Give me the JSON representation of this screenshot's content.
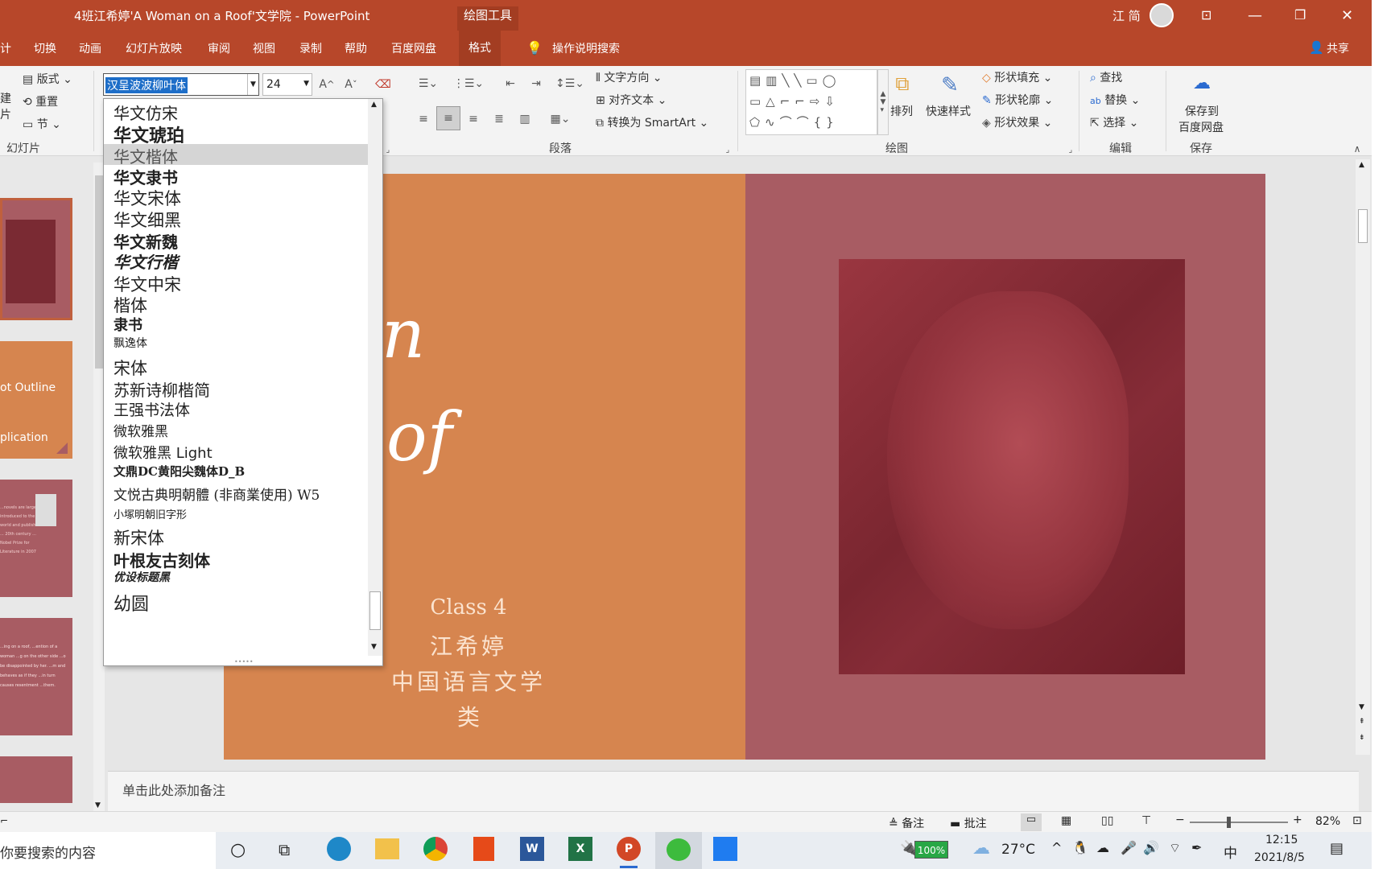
{
  "window": {
    "title": "4班江希婷'A Woman on a Roof'文学院  -  PowerPoint",
    "context_tool": "绘图工具",
    "user": "江 简"
  },
  "tabs": [
    "计",
    "切换",
    "动画",
    "幻灯片放映",
    "审阅",
    "视图",
    "录制",
    "帮助",
    "百度网盘",
    "格式"
  ],
  "tell_me": "操作说明搜索",
  "share": "共享",
  "ribbon": {
    "slides_group": {
      "layout": "版式",
      "reset": "重置",
      "section": "节",
      "label": "幻灯片",
      "left_a": "建",
      "left_b": "片"
    },
    "font": {
      "name": "汉呈波波柳叶体",
      "size": "24"
    },
    "paragraph": {
      "text_direction": "文字方向",
      "align_text": "对齐文本",
      "smartart": "转换为 SmartArt",
      "label": "段落"
    },
    "drawing": {
      "arrange": "排列",
      "quick_styles": "快速样式",
      "shape_fill": "形状填充",
      "shape_outline": "形状轮廓",
      "shape_effects": "形状效果",
      "label": "绘图"
    },
    "editing": {
      "find": "查找",
      "replace": "替换",
      "select": "选择",
      "label": "编辑"
    },
    "save": {
      "line1": "保存到",
      "line2": "百度网盘",
      "label": "保存"
    }
  },
  "font_list": [
    "华文仿宋",
    "华文琥珀",
    "华文楷体",
    "华文隶书",
    "华文宋体",
    "华文细黑",
    "华文新魏",
    "华文行楷",
    "华文中宋",
    "楷体",
    "隶书",
    "飘逸体",
    "宋体",
    "苏新诗柳楷简",
    "王强书法体",
    "微软雅黑",
    "微软雅黑 Light",
    "文鼎DC黄阳尖魏体D_B",
    "文悦古典明朝體 (非商業使用) W5",
    "小塚明朝旧字形",
    "新宋体",
    "叶根友古刻体",
    "优设标题黑",
    "幼圆"
  ],
  "font_list_selected_index": 2,
  "thumbnails": {
    "t2a": "ot Outline",
    "t2b": "plication",
    "t3": "...novels are largely introduced to the world and published ... 20th century ... Nobel Prize for Literature in 2007",
    "t4": "...ing on a roof, ...ention of a woman ...g on the other side ...o be disappointed by her. ...m and behaves as if they ...in turn causes resentment ...them."
  },
  "slide": {
    "title_part1": "n",
    "title_part2": "of",
    "class": "Class 4",
    "name": "江希婷",
    "dept": "中国语言文学",
    "dept2": "类",
    "left_color": "#d6854f",
    "right_color": "#a85c63",
    "photo_color": "#8c2a34"
  },
  "notes_placeholder": "单击此处添加备注",
  "status": {
    "notes": "备注",
    "comments": "批注",
    "zoom": "82%"
  },
  "taskbar": {
    "search": "你要搜索的内容",
    "battery": "100%",
    "temp": "27°C",
    "ime": "中",
    "time": "12:15",
    "date": "2021/8/5"
  }
}
